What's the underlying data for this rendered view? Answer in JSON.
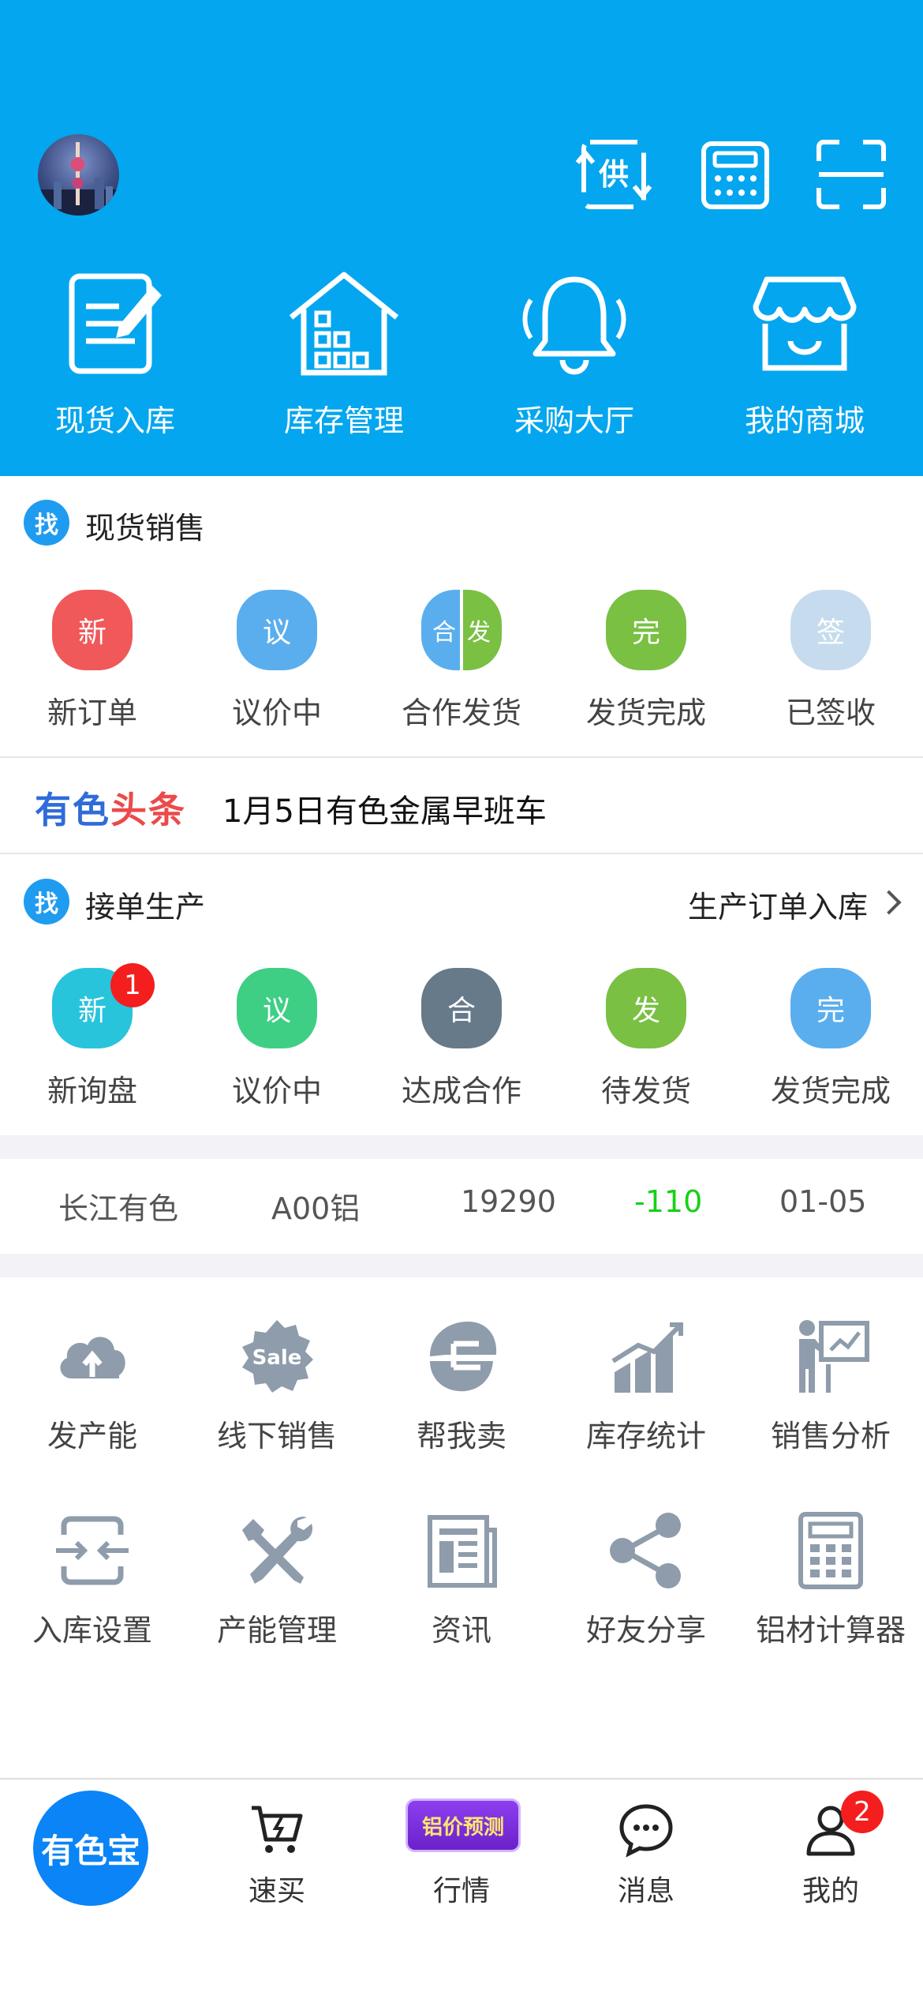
{
  "header": {
    "quick_icons": [
      {
        "name": "supply-icon",
        "text": "供"
      },
      {
        "name": "calculator-icon"
      },
      {
        "name": "scan-icon"
      }
    ],
    "tiles": [
      {
        "label": "现货入库",
        "icon": "edit-document-icon"
      },
      {
        "label": "库存管理",
        "icon": "warehouse-icon"
      },
      {
        "label": "采购大厅",
        "icon": "bell-icon"
      },
      {
        "label": "我的商城",
        "icon": "shop-icon"
      }
    ]
  },
  "spot_sales": {
    "badge": "找",
    "title": "现货销售",
    "items": [
      {
        "label": "新订单",
        "icon_text": "新",
        "color": "#f0585a"
      },
      {
        "label": "议价中",
        "icon_text": "议",
        "color": "#5aaeee"
      },
      {
        "label": "合作发货",
        "icon_text_left": "合",
        "icon_text_right": "发",
        "color_left": "#5aaeee",
        "color_right": "#7ac043"
      },
      {
        "label": "发货完成",
        "icon_text": "完",
        "color": "#7ac043"
      },
      {
        "label": "已签收",
        "icon_text": "签",
        "color": "#c6dcee"
      }
    ]
  },
  "headline": {
    "brand_part1": "有色",
    "brand_part2": "头条",
    "text": "1月5日有色金属早班车"
  },
  "production": {
    "badge": "找",
    "title": "接单生产",
    "link": "生产订单入库",
    "items": [
      {
        "label": "新询盘",
        "icon_text": "新",
        "color": "#27c4dc",
        "badge": "1"
      },
      {
        "label": "议价中",
        "icon_text": "议",
        "color": "#3ecf84"
      },
      {
        "label": "达成合作",
        "icon_text": "合",
        "color": "#667a8a"
      },
      {
        "label": "待发货",
        "icon_text": "发",
        "color": "#7ac043"
      },
      {
        "label": "发货完成",
        "icon_text": "完",
        "color": "#5aaeee"
      }
    ]
  },
  "price": {
    "market": "长江有色",
    "product": "A00铝",
    "value": "19290",
    "change": "-110",
    "date": "01-05",
    "change_color": "#17d017"
  },
  "tools": [
    {
      "label": "发产能",
      "icon": "cloud-upload-icon"
    },
    {
      "label": "线下销售",
      "icon": "sale-badge-icon",
      "icon_text": "Sale"
    },
    {
      "label": "帮我卖",
      "icon": "help-sell-icon"
    },
    {
      "label": "库存统计",
      "icon": "bar-chart-icon"
    },
    {
      "label": "销售分析",
      "icon": "presentation-icon"
    },
    {
      "label": "入库设置",
      "icon": "inbound-settings-icon"
    },
    {
      "label": "产能管理",
      "icon": "tools-icon"
    },
    {
      "label": "资讯",
      "icon": "newspaper-icon"
    },
    {
      "label": "好友分享",
      "icon": "share-icon"
    },
    {
      "label": "铝材计算器",
      "icon": "calculator-icon"
    }
  ],
  "tabbar": {
    "home": "有色宝",
    "quick_buy": "速买",
    "forecast_badge": "铝价预测",
    "market": "行情",
    "messages": "消息",
    "me": "我的",
    "me_badge": "2"
  }
}
